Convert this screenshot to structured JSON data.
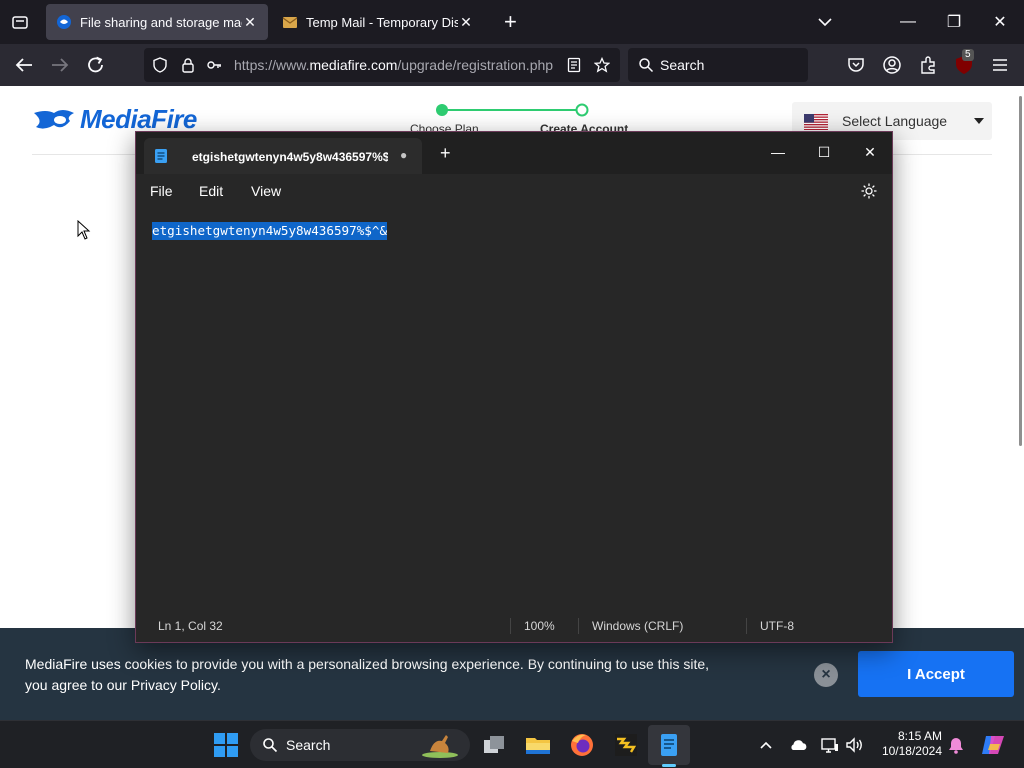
{
  "browser": {
    "tabs": [
      {
        "title": "File sharing and storage made s",
        "active": true
      },
      {
        "title": "Temp Mail - Temporary Dispos",
        "active": false
      }
    ],
    "url_prefix": "https://www.",
    "url_domain": "mediafire.com",
    "url_path": "/upgrade/registration.php",
    "search_placeholder": "Search",
    "extension_badge": "5"
  },
  "page": {
    "logo_text": "MediaFire",
    "steps": [
      "Choose Plan",
      "Create Account"
    ],
    "language_label": "Select Language"
  },
  "cookie": {
    "text_part1": "MediaFire uses ",
    "text_part2": "cookies",
    "text_part3": " to provide you with a personalized browsing experience. By continuing to use this site, you agree to our ",
    "text_link": "Privacy Policy",
    "text_end": ".",
    "accept_label": "I Accept",
    "close_label": "×"
  },
  "notepad": {
    "tab_title": "etgishetgwtenyn4w5y8w436597%$",
    "menu": [
      "File",
      "Edit",
      "View"
    ],
    "content": "etgishetgwtenyn4w5y8w436597%$^&",
    "status": {
      "position": "Ln 1, Col 32",
      "zoom": "100%",
      "line_ending": "Windows (CRLF)",
      "encoding": "UTF-8"
    }
  },
  "taskbar": {
    "search_label": "Search",
    "time": "8:15 AM",
    "date": "10/18/2024"
  },
  "colors": {
    "accent": "#1672f3",
    "selection": "#0f66c9",
    "step_green": "#2ecc71",
    "cookie_bg": "#253441"
  }
}
